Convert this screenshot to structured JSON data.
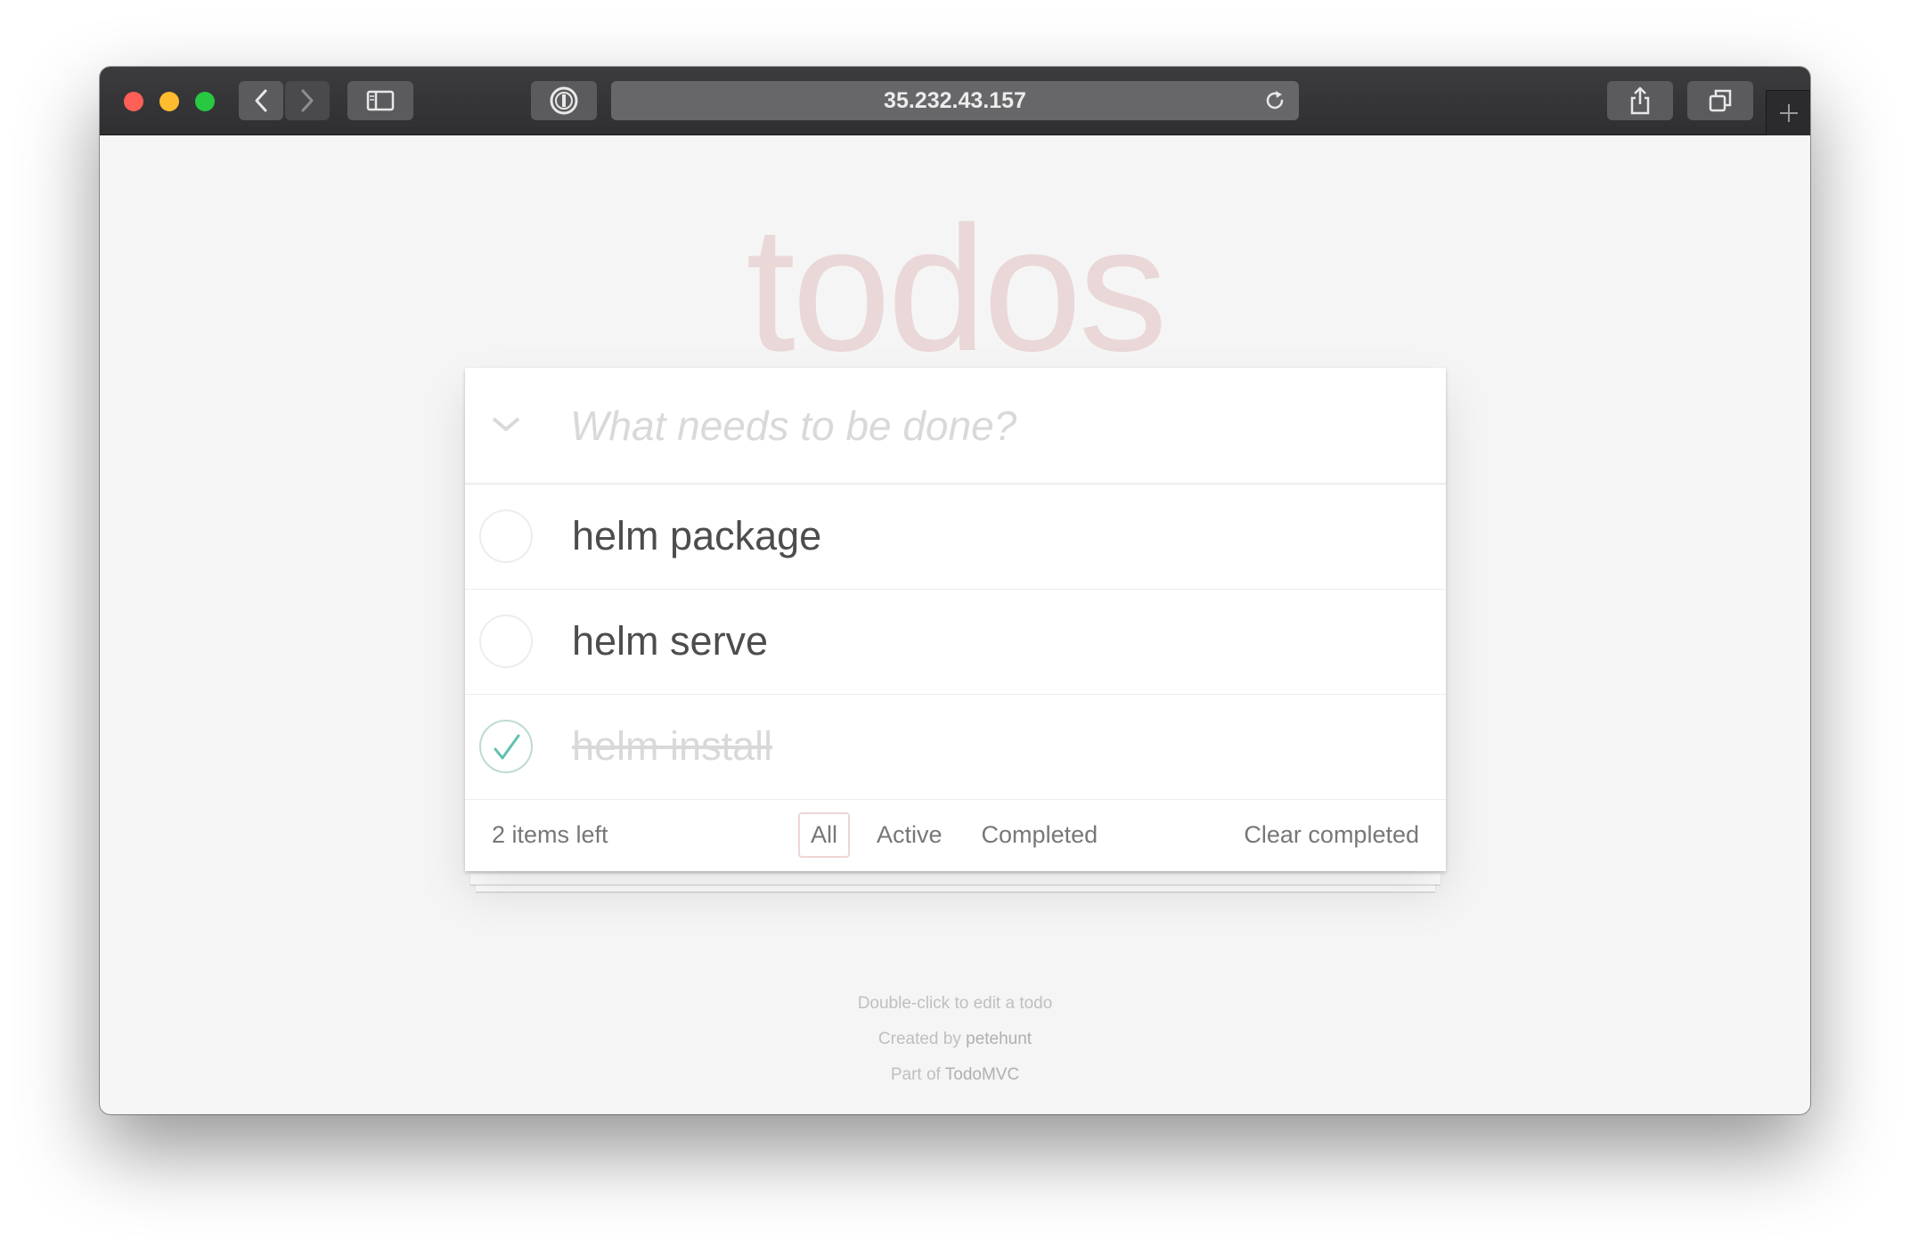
{
  "browser": {
    "url": "35.232.43.157"
  },
  "app": {
    "heading": "todos",
    "new_todo_placeholder": "What needs to be done?",
    "todos": [
      {
        "title": "helm package",
        "completed": false
      },
      {
        "title": "helm serve",
        "completed": false
      },
      {
        "title": "helm install",
        "completed": true
      }
    ],
    "footer": {
      "count": "2 items left",
      "filters": [
        "All",
        "Active",
        "Completed"
      ],
      "selected_filter": "All",
      "clear_completed": "Clear completed"
    }
  },
  "info": {
    "edit_hint": "Double-click to edit a todo",
    "created_by_prefix": "Created by",
    "created_by_name": "petehunt",
    "part_of_prefix": "Part of",
    "part_of_name": "TodoMVC"
  },
  "colors": {
    "heading": "#f1dede",
    "check_done": "#5dc2af",
    "filter_selected_border": "#efd6d6"
  }
}
